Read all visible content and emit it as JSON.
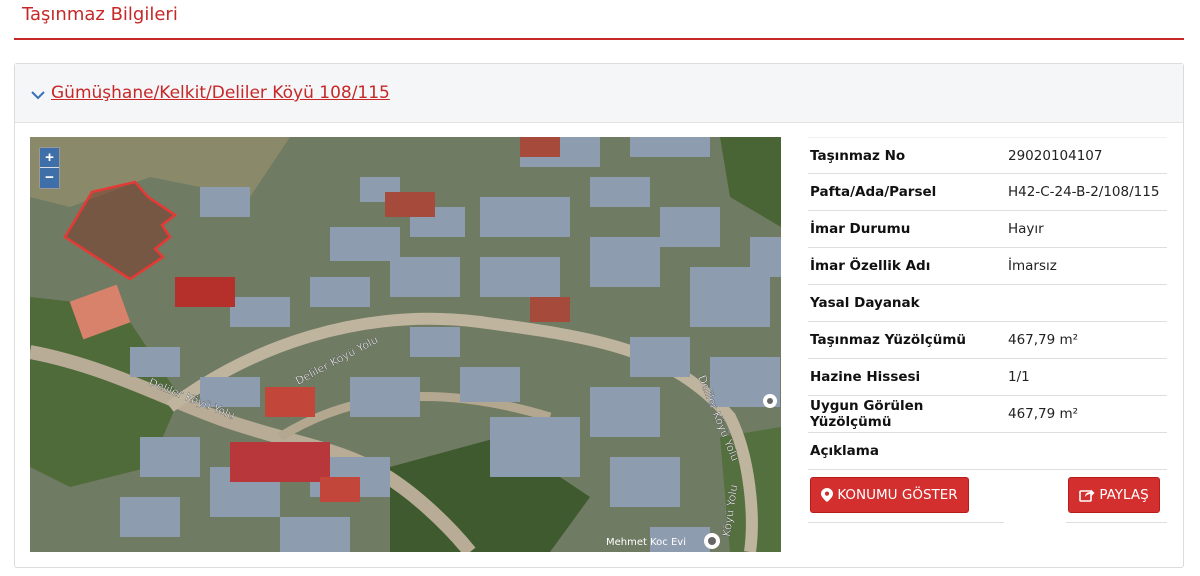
{
  "header": {
    "title": "Taşınmaz Bilgileri"
  },
  "panel": {
    "link_text": "Gümüşhane/Kelkit/Deliler Köyü 108/115"
  },
  "map": {
    "zoom_in": "+",
    "zoom_out": "−",
    "road_label_1": "Deliler Köyü Yolu",
    "road_label_2": "Deliler Köyü Yolu",
    "road_label_3": "Deliler Köyü Yolu",
    "road_label_4": "Köyü Yolu",
    "poi_label": "Mehmet Koc Evi"
  },
  "details": [
    {
      "label": "Taşınmaz No",
      "value": "29020104107"
    },
    {
      "label": "Pafta/Ada/Parsel",
      "value": "H42-C-24-B-2/108/115"
    },
    {
      "label": "İmar Durumu",
      "value": "Hayır"
    },
    {
      "label": "İmar Özellik Adı",
      "value": "İmarsız"
    },
    {
      "label": "Yasal Dayanak",
      "value": ""
    },
    {
      "label": "Taşınmaz Yüzölçümü",
      "value": "467,79 m²"
    },
    {
      "label": "Hazine Hissesi",
      "value": "1/1"
    },
    {
      "label": "Uygun Görülen Yüzölçümü",
      "value": "467,79 m²"
    },
    {
      "label": "Açıklama",
      "value": ""
    }
  ],
  "actions": {
    "show_location": "KONUMU GÖSTER",
    "share": "PAYLAŞ"
  },
  "colors": {
    "accent": "#c62828",
    "button": "#d32f2f"
  }
}
